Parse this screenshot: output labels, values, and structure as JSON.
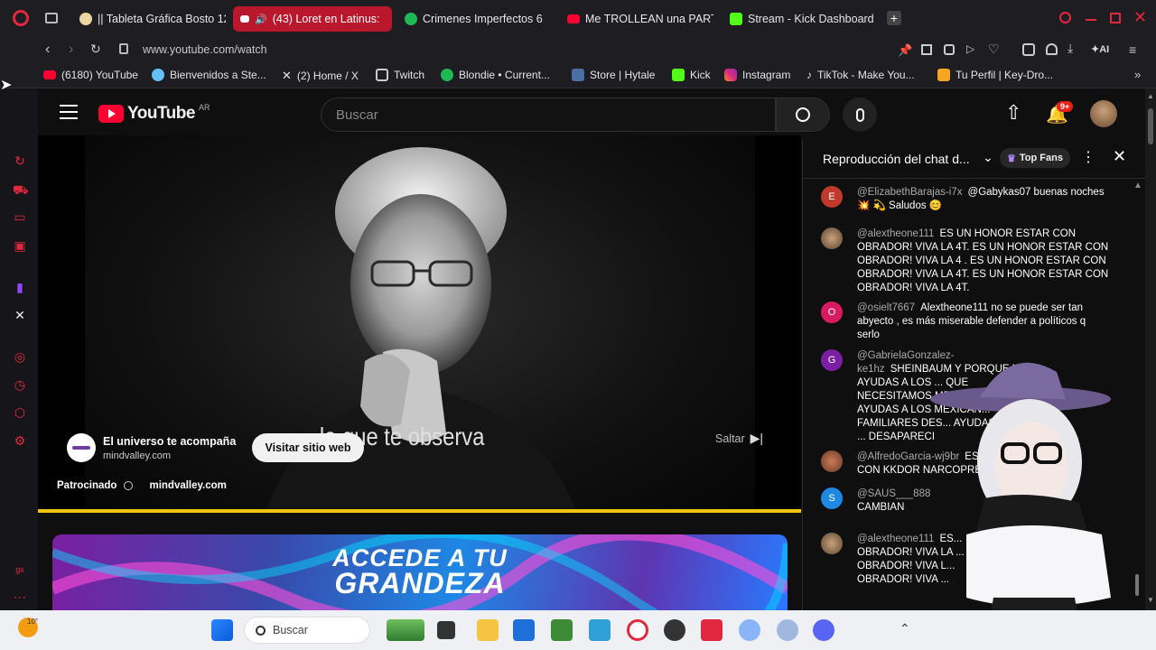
{
  "browser": {
    "tabs": [
      {
        "label": "|| Tableta Gráfica Bosto 12",
        "color": "#e8d7a0",
        "active": false
      },
      {
        "label": "(43) Loret en Latinus:",
        "color": "#ff0033",
        "active": true
      },
      {
        "label": "Crimenes Imperfectos 6",
        "color": "#1db954",
        "active": false
      },
      {
        "label": "Me TROLLEAN una PARTI",
        "color": "#ff0033",
        "active": false
      },
      {
        "label": "Stream - Kick Dashboard",
        "color": "#53fc18",
        "active": false
      }
    ],
    "url": "www.youtube.com/watch",
    "bookmarks": [
      {
        "label": "(6180) YouTube",
        "color": "#ff0033"
      },
      {
        "label": "Bienvenidos a Ste...",
        "color": "#66c0f4"
      },
      {
        "label": "(2) Home / X",
        "color": "#e6e6e6"
      },
      {
        "label": "Twitch",
        "color": "#9146ff"
      },
      {
        "label": "Blondie • Current...",
        "color": "#1db954"
      },
      {
        "label": "Store | Hytale",
        "color": "#4a6fa5"
      },
      {
        "label": "Kick",
        "color": "#53fc18"
      },
      {
        "label": "Instagram",
        "color": "#e1306c"
      },
      {
        "label": "TikTok - Make You...",
        "color": "#ffffff"
      },
      {
        "label": "Tu Perfil | Key-Dro...",
        "color": "#f5a623"
      }
    ],
    "ai_label": "AI"
  },
  "youtube": {
    "logo_text": "YouTube",
    "region": "AR",
    "search_placeholder": "Buscar",
    "notifications": "9+"
  },
  "video": {
    "caption": "...la que te observa",
    "ad_title": "El universo te acompaña",
    "ad_domain": "mindvalley.com",
    "visit_label": "Visitar sitio web",
    "skip_label": "Saltar",
    "sponsored_label": "Patrocinado",
    "sponsored_domain": "mindvalley.com"
  },
  "banner": {
    "line1": "ACCEDE A TU",
    "line2": "GRANDEZA"
  },
  "chat": {
    "title": "Reproducción del chat d...",
    "top_fans": "Top Fans",
    "messages": [
      {
        "avatar": "E",
        "color": "#c0392b",
        "author": "@ElizabethBarajas-i7x",
        "text": "@Gabykas07 buenas noches 💥 💫 Saludos 😊"
      },
      {
        "avatar": "",
        "color": "#7a6a55",
        "author": "@alextheone111",
        "text": "ES UN HONOR ESTAR CON OBRADOR! VIVA LA 4T. ES UN HONOR ESTAR CON OBRADOR! VIVA LA 4 . ES UN HONOR ESTAR CON OBRADOR! VIVA LA 4T. ES UN HONOR ESTAR CON OBRADOR! VIVA LA 4T."
      },
      {
        "avatar": "O",
        "color": "#d81b60",
        "author": "@osielt7667",
        "text": "Alextheone111 no se puede ser tan abyecto , es más miserable defender a políticos q serlo"
      },
      {
        "avatar": "G",
        "color": "#7b1fa2",
        "author": "@GabrielaGonzalez-ke1hz",
        "text": "SHEINBAUM Y PORQUE NO AYUDAS A LOS ... QUE NECESITAMOS MEDICAME... NO AYUDAS A LOS MEXICAN... FAMILIARES DES... AYUDAS A LOS ... DESAPARECI"
      },
      {
        "avatar": "",
        "color": "#a0522d",
        "author": "@AlfredoGarcia-wj9br",
        "text": "ES... CON KKDOR NARCOPRE..."
      },
      {
        "avatar": "S",
        "color": "#1e88e5",
        "author": "@SAUS___888",
        "text": "CAMBIAN"
      },
      {
        "avatar": "",
        "color": "#7a6a55",
        "author": "@alextheone111",
        "text": "ES... OBRADOR! VIVA LA ... OBRADOR! VIVA L... OBRADOR! VIVA ..."
      }
    ]
  },
  "taskbar": {
    "weather": "10°",
    "search_placeholder": "Buscar"
  },
  "sidebar_icons": [
    "refresh-icon",
    "shopping-icon",
    "tv-icon",
    "media-icon",
    "twitch-icon",
    "x-icon",
    "play-icon",
    "history-icon",
    "extensions-icon",
    "settings-icon"
  ]
}
